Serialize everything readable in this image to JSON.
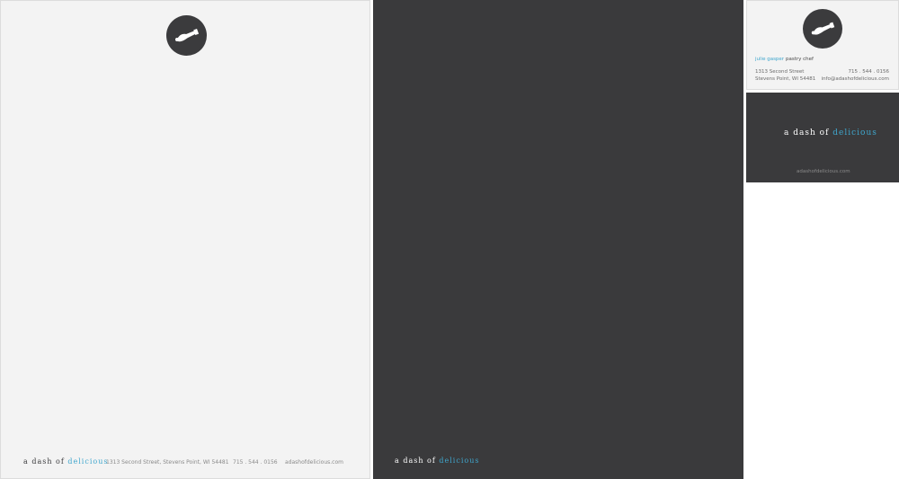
{
  "brand": {
    "word_a": "a",
    "word_dash": "dash",
    "word_of": "of",
    "word_delicious": "delicious",
    "accent_color": "#3fa6cd",
    "dark_color": "#3a3a3c",
    "light_color": "#f3f3f3",
    "logo_icon": "hand-holding-icon"
  },
  "letterhead": {
    "address": "1313 Second Street, Stevens Point, WI 54481",
    "phone": "715 . 544 . 0156",
    "website": "adashofdelicious.com"
  },
  "business_card": {
    "name": "julie gasper",
    "title": "pastry chef",
    "address_line1": "1313 Second Street",
    "address_line2": "Stevens Point, WI 54481",
    "phone": "715 . 544 . 0156",
    "email": "info@adashofdelicious.com",
    "back_website": "adashofdelicious.com"
  }
}
